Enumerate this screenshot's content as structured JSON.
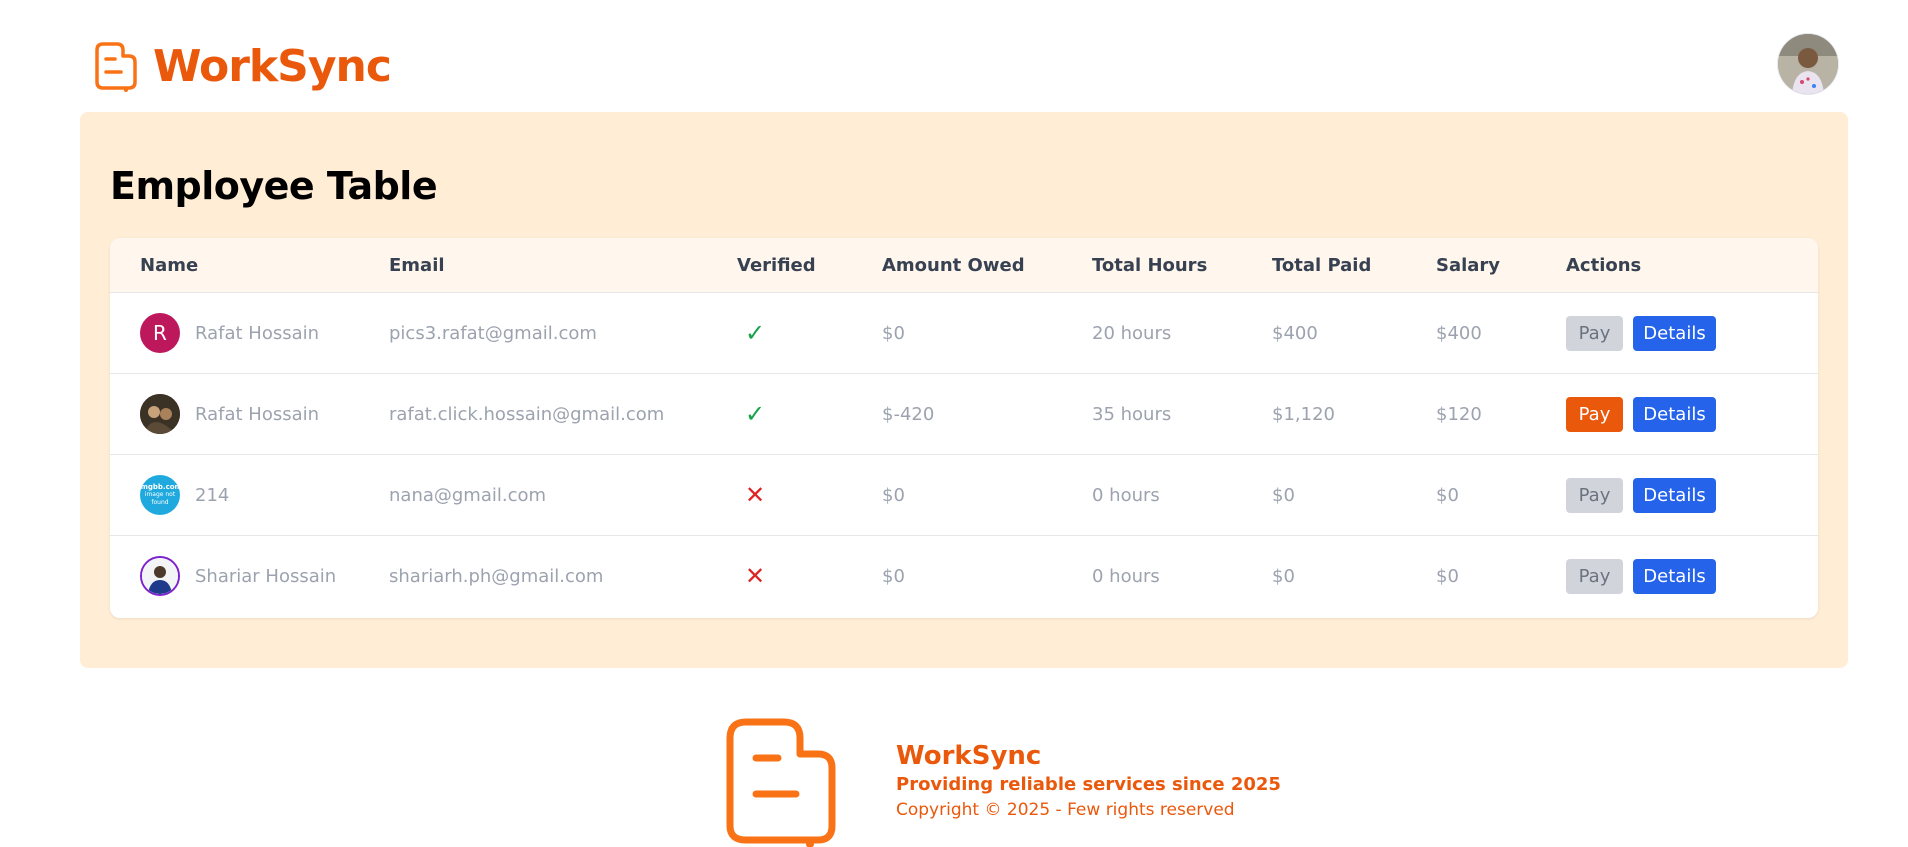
{
  "brand": {
    "name": "WorkSync",
    "accent": "#ea580c"
  },
  "header": {
    "avatar_icon": "user-avatar"
  },
  "page": {
    "title": "Employee Table"
  },
  "table": {
    "columns": [
      "Name",
      "Email",
      "Verified",
      "Amount Owed",
      "Total Hours",
      "Total Paid",
      "Salary",
      "Actions"
    ],
    "rows": [
      {
        "name": "Rafat Hossain",
        "avatar_letter": "R",
        "email": "pics3.rafat@gmail.com",
        "verified": true,
        "verified_mark": "✓",
        "owed": "$0",
        "hours": "20 hours",
        "paid": "$400",
        "salary": "$400",
        "pay_label": "Pay",
        "pay_enabled": false,
        "details_label": "Details"
      },
      {
        "name": "Rafat Hossain",
        "avatar_letter": "",
        "email": "rafat.click.hossain@gmail.com",
        "verified": true,
        "verified_mark": "✓",
        "owed": "$-420",
        "hours": "35 hours",
        "paid": "$1,120",
        "salary": "$120",
        "pay_label": "Pay",
        "pay_enabled": true,
        "details_label": "Details"
      },
      {
        "name": "214",
        "avatar_letter": "",
        "avatar_text_1": "imgbb.com",
        "avatar_text_2": "image not found",
        "email": "nana@gmail.com",
        "verified": false,
        "verified_mark": "✕",
        "owed": "$0",
        "hours": "0 hours",
        "paid": "$0",
        "salary": "$0",
        "pay_label": "Pay",
        "pay_enabled": false,
        "details_label": "Details"
      },
      {
        "name": "Shariar Hossain",
        "avatar_letter": "",
        "email": "shariarh.ph@gmail.com",
        "verified": false,
        "verified_mark": "✕",
        "owed": "$0",
        "hours": "0 hours",
        "paid": "$0",
        "salary": "$0",
        "pay_label": "Pay",
        "pay_enabled": false,
        "details_label": "Details"
      }
    ]
  },
  "footer": {
    "name": "WorkSync",
    "tagline": "Providing reliable services since 2025",
    "copyright": "Copyright © 2025 - Few rights reserved"
  }
}
